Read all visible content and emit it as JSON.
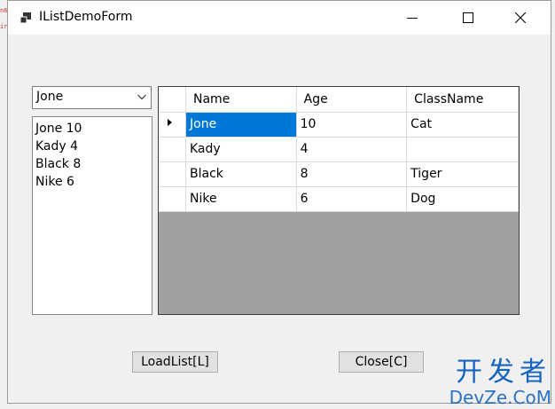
{
  "edge_marks": [
    "n6",
    "ir"
  ],
  "window": {
    "title": "IListDemoForm",
    "icons": {
      "app": "app-window-icon",
      "minimize": "minimize-icon",
      "maximize": "maximize-icon",
      "close": "close-icon"
    }
  },
  "combo": {
    "selected": "Jone",
    "arrow_icon": "chevron-down-icon"
  },
  "listbox": {
    "items": [
      "Jone 10",
      "Kady 4",
      "Black 8",
      "Nike 6"
    ]
  },
  "grid": {
    "columns": [
      "Name",
      "Age",
      "ClassName"
    ],
    "current_row_icon": "triangle-right-icon",
    "rows": [
      [
        "Jone",
        "10",
        "Cat"
      ],
      [
        "Kady",
        "4",
        ""
      ],
      [
        "Black",
        "8",
        "Tiger"
      ],
      [
        "Nike",
        "6",
        "Dog"
      ]
    ],
    "selection_color": "#0078d7",
    "empty_area_color": "#a0a0a0"
  },
  "buttons": {
    "load": "LoadList[L]",
    "close": "Close[C]"
  },
  "watermark": {
    "cn": "开发者",
    "en": "DevZe.CoM"
  }
}
